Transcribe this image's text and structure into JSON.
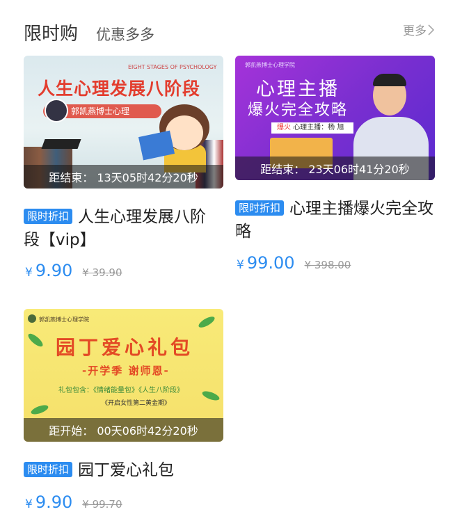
{
  "header": {
    "title": "限时购",
    "subtitle": "优惠多多",
    "more_label": "更多"
  },
  "products": [
    {
      "countdown": "距结束： 13天05时42分20秒",
      "tag": "限时折扣",
      "name": "人生心理发展八阶段【vip】",
      "price_symbol": "¥",
      "price": "9.90",
      "original_price": "¥ 39.90",
      "thumb": {
        "title": "人生心理发展八阶段",
        "subtitle": "EIGHT STAGES OF PSYCHOLOGY",
        "ribbon": "郭凯燕博士心理"
      }
    },
    {
      "countdown": "距结束： 23天06时41分20秒",
      "tag": "限时折扣",
      "name": "心理主播爆火完全攻略",
      "price_symbol": "¥",
      "price": "99.00",
      "original_price": "¥ 398.00",
      "thumb": {
        "org": "郭凯燕博士心理学院",
        "title_line1": "心理主播",
        "title_line2": "爆火完全攻略",
        "label_highlight": "爆火",
        "label_rest": "心理主播：杨 旭"
      }
    },
    {
      "countdown": "距开始： 00天06时42分20秒",
      "tag": "限时折扣",
      "name": "园丁爱心礼包",
      "price_symbol": "¥",
      "price": "9.90",
      "original_price": "¥ 99.70",
      "thumb": {
        "org": "郭凯燕博士心理学院",
        "title": "园丁爱心礼包",
        "slogan": "-开学季 谢师恩-",
        "line1": "礼包包含：《情绪能量包》《人生八阶段》",
        "line2": "《开启女性第二黄金期》"
      }
    }
  ],
  "colors": {
    "accent": "#2c8cf0",
    "tag_bg": "#2c8cf0",
    "strike": "#999999"
  }
}
